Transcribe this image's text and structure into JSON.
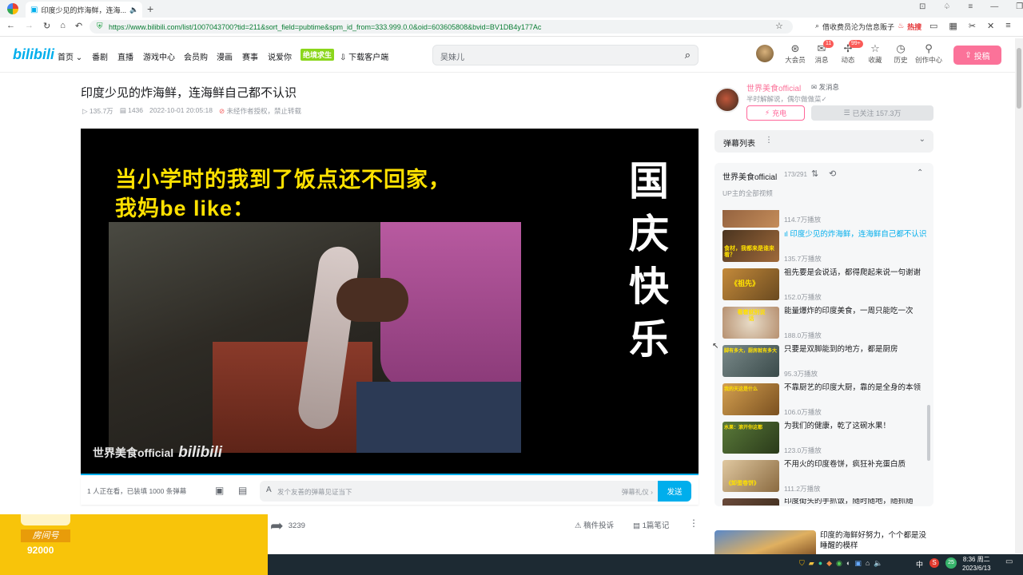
{
  "browser": {
    "tab_title": "印度少见的炸海鲜，连海...",
    "url": "https://www.bilibili.com/list/1007043700?tid=211&sort_field=pubtime&spm_id_from=333.999.0.0&oid=603605808&bvid=BV1DB4y177Ac",
    "search_hint": "借收费员沦为信息贩子",
    "hot_label": "热搜"
  },
  "nav": {
    "logo": "bilibili",
    "items": [
      "首页",
      "番剧",
      "直播",
      "游戏中心",
      "会员购",
      "漫画",
      "赛事",
      "说爱你",
      "绝境求生",
      "下载客户端"
    ],
    "search_placeholder": "吴妹儿",
    "right_items": [
      "大会员",
      "消息",
      "动态",
      "收藏",
      "历史",
      "创作中心"
    ],
    "msg_badge": "11",
    "dyn_badge": "99+",
    "upload": "投稿"
  },
  "video": {
    "title": "印度少见的炸海鲜，连海鲜自己都不认识",
    "plays": "135.7万",
    "danmaku": "1436",
    "date": "2022-10-01 20:05:18",
    "copyright": "未经作者授权，禁止转载",
    "caption_line1": "当小学时的我到了饭点还不回家，",
    "caption_line2": "我妈be like：",
    "side_text": [
      "国",
      "庆",
      "快",
      "乐"
    ],
    "watermark": "世界美食official",
    "watermark_logo": "bilibili"
  },
  "danmaku_bar": {
    "online": "1 人正在看，已装填 1000 条弹幕",
    "input_placeholder": "发个友善的弹幕见证当下",
    "etiquette": "弹幕礼仪",
    "send": "发送"
  },
  "actions": {
    "share_count": "3239",
    "report": "稿件投诉",
    "notes": "1篇笔记"
  },
  "overlay": {
    "label1": "房间号",
    "room": "92000"
  },
  "uploader": {
    "name": "世界美食official",
    "message": "发消息",
    "desc": "半时解解说，偶尔做做菜✓",
    "charge": "充电",
    "follow": "已关注 157.3万"
  },
  "danmaku_list": {
    "label": "弹幕列表"
  },
  "playlist": {
    "title": "世界美食official",
    "count": "173/291",
    "subtitle": "UP主的全部视频",
    "items": [
      {
        "title": "",
        "views": "114.7万播放"
      },
      {
        "title": "印度少见的炸海鲜，连海鲜自己都不认识",
        "views": "135.7万播放",
        "thumb_text": "食材，我都来是谁来看？"
      },
      {
        "title": "祖先要是会说话，都得爬起来说一句谢谢",
        "views": "152.0万播放",
        "thumb_text": "《祖先》"
      },
      {
        "title": "能量爆炸的印度美食，一周只能吃一次",
        "views": "188.0万播放",
        "thumb_text": "看着就别说话"
      },
      {
        "title": "只要是双脚能到的地方，都是厨房",
        "views": "95.3万播放",
        "thumb_text": "脚有多大，厨房就有多大"
      },
      {
        "title": "不靠厨艺的印度大厨，靠的是全身的本领",
        "views": "106.0万播放",
        "thumb_text": "我的天这是什么"
      },
      {
        "title": "为我们的健康，乾了这碗水果！",
        "views": "123.0万播放",
        "thumb_text": "水果：滚开你这都"
      },
      {
        "title": "不用火的印度卷饼，疯狂补充蛋白质",
        "views": "111.2万播放",
        "thumb_text": "《卸蛋卷饼》"
      },
      {
        "title": "印度街头的手抓饭，随时随地，随抓随",
        "views": ""
      }
    ]
  },
  "next_rec": {
    "title": "印度的海鲜好努力，个个都是没睡醒的模样"
  },
  "taskbar": {
    "time": "8:36 周二",
    "date": "2023/6/13",
    "ime": "中",
    "badge": "25"
  },
  "colors": {
    "brand_pink": "#fb7299",
    "brand_blue": "#00aeec",
    "caption_yellow": "#ffe100",
    "overlay_yellow": "#f8c40a"
  }
}
